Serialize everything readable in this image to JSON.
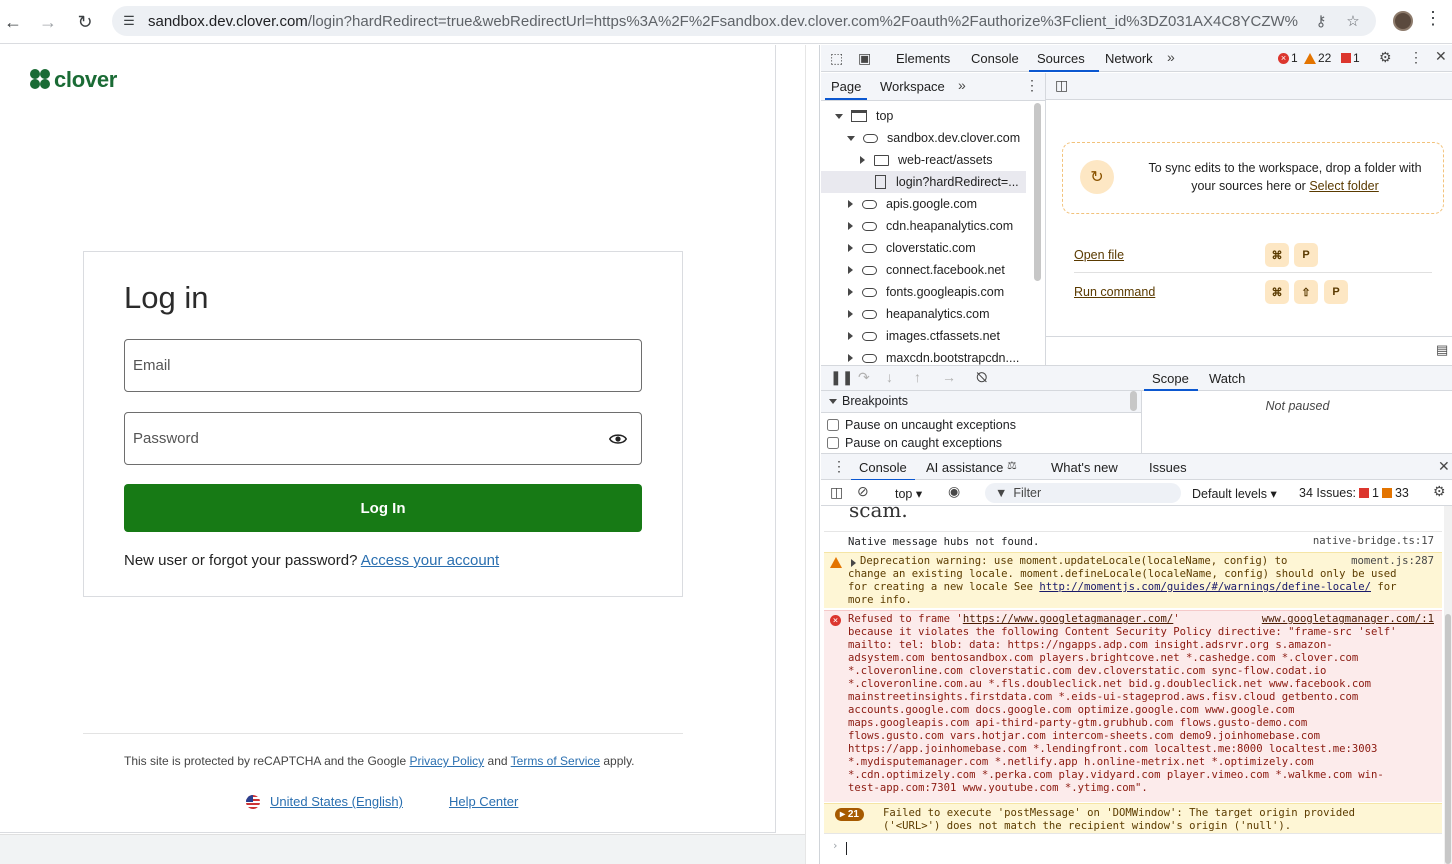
{
  "browser": {
    "url_host": "sandbox.dev.clover.com",
    "url_rest": "/login?hardRedirect=true&webRedirectUrl=https%3A%2F%2Fsandbox.dev.clover.com%2Foauth%2Fauthorize%3Fclient_id%3DZ031AX4C8YCZW%..."
  },
  "page": {
    "logo_text": "clover",
    "login": {
      "title": "Log in",
      "email_placeholder": "Email",
      "password_placeholder": "Password",
      "submit_label": "Log In",
      "help_prefix": "New user or forgot your password?",
      "help_link": "Access your account"
    },
    "footer": {
      "recaptcha_prefix": "This site is protected by reCAPTCHA and the Google",
      "privacy_link": "Privacy Policy",
      "and": "and",
      "terms_link": "Terms of Service",
      "suffix": "apply.",
      "locale_link": "United States (English)",
      "help_center": "Help Center"
    }
  },
  "devtools": {
    "main_tabs": [
      "Elements",
      "Console",
      "Sources",
      "Network"
    ],
    "active_main_tab": "Sources",
    "badges": {
      "errors": "1",
      "warnings": "22",
      "issues": "1"
    },
    "sources_tabs": [
      "Page",
      "Workspace"
    ],
    "tree": [
      {
        "label": "top",
        "icon": "frame"
      },
      {
        "label": "sandbox.dev.clover.com",
        "icon": "cloud"
      },
      {
        "label": "web-react/assets",
        "icon": "folder"
      },
      {
        "label": "login?hardRedirect=...",
        "icon": "file"
      },
      {
        "label": "apis.google.com",
        "icon": "cloud"
      },
      {
        "label": "cdn.heapanalytics.com",
        "icon": "cloud"
      },
      {
        "label": "cloverstatic.com",
        "icon": "cloud"
      },
      {
        "label": "connect.facebook.net",
        "icon": "cloud"
      },
      {
        "label": "fonts.googleapis.com",
        "icon": "cloud"
      },
      {
        "label": "heapanalytics.com",
        "icon": "cloud"
      },
      {
        "label": "images.ctfassets.net",
        "icon": "cloud"
      },
      {
        "label": "maxcdn.bootstrapcdn....",
        "icon": "cloud"
      }
    ],
    "workspace": {
      "sync_text": "To sync edits to the workspace, drop a folder with your sources here or",
      "select_folder": "Select folder",
      "open_file": "Open file",
      "run_command": "Run command",
      "key_cmd": "⌘",
      "key_p": "P",
      "key_shift": "⇧"
    },
    "debugger": {
      "breakpoints_title": "Breakpoints",
      "pause_uncaught": "Pause on uncaught exceptions",
      "pause_caught": "Pause on caught exceptions",
      "scope_tab": "Scope",
      "watch_tab": "Watch",
      "not_paused": "Not paused"
    },
    "console": {
      "tabs": [
        "Console",
        "AI assistance",
        "What's new",
        "Issues"
      ],
      "context": "top",
      "filter_placeholder": "Filter",
      "levels": "Default levels",
      "issues_label": "34 Issues:",
      "issues_errors": "1",
      "issues_warnings": "33",
      "scam_text": "scam.",
      "native_msg": "Native message hubs not found.",
      "native_src": "native-bridge.ts:17",
      "deprecation_line1": "Deprecation warning: use moment.updateLocale(localeName, config) to",
      "deprecation_line2": "change an existing locale. moment.defineLocale(localeName, config) should only be used",
      "deprecation_line3_prefix": "for creating a new locale See ",
      "deprecation_link": "http://momentjs.com/guides/#/warnings/define-locale/",
      "deprecation_line3_suffix": " for",
      "deprecation_line4": "more info.",
      "deprecation_src": "moment.js:287",
      "csp_prefix": "Refused to frame '",
      "csp_link": "https://www.googletagmanager.com/",
      "csp_suffix": "'",
      "csp_src": "www.googletagmanager.com/:1",
      "csp_lines": [
        "because it violates the following Content Security Policy directive: \"frame-src 'self'",
        "mailto: tel: blob: data: https://ngapps.adp.com insight.adsrvr.org s.amazon-",
        "adsystem.com bentosandbox.com players.brightcove.net *.cashedge.com *.clover.com",
        "*.cloveronline.com cloverstatic.com dev.cloverstatic.com sync-flow.codat.io",
        "*.cloveronline.com.au *.fls.doubleclick.net bid.g.doubleclick.net www.facebook.com",
        "mainstreetinsights.firstdata.com *.eids-ui-stageprod.aws.fisv.cloud getbento.com",
        "accounts.google.com docs.google.com optimize.google.com www.google.com",
        "maps.googleapis.com api-third-party-gtm.grubhub.com flows.gusto-demo.com",
        "flows.gusto.com vars.hotjar.com intercom-sheets.com demo9.joinhomebase.com",
        "https://app.joinhomebase.com *.lendingfront.com localtest.me:8000 localtest.me:3003",
        "*.mydisputemanager.com *.netlify.app h.online-metrix.net *.optimizely.com",
        "*.cdn.optimizely.com *.perka.com play.vidyard.com player.vimeo.com *.walkme.com win-",
        "test-app.com:7301 www.youtube.com *.ytimg.com\"."
      ],
      "post_count": "21",
      "post_line1": "Failed to execute 'postMessage' on 'DOMWindow': The target origin provided",
      "post_line2": "('<URL>') does not match the recipient window's origin ('null')."
    }
  }
}
